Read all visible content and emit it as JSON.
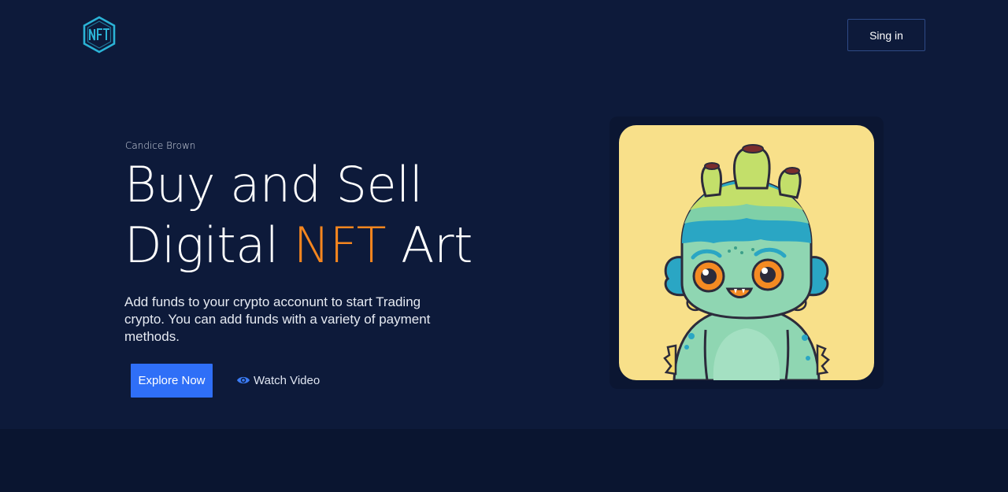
{
  "header": {
    "logo_text": "NFT",
    "signin_label": "Sing in"
  },
  "hero": {
    "author": "Candice Brown",
    "headline_line1": "Buy and Sell",
    "headline_line2_pre": "Digital ",
    "headline_line2_accent": "NFT",
    "headline_line2_post": " Art",
    "description": "Add funds to your crypto acconunt to start Trading crypto. You can add funds with a variety of payment methods.",
    "explore_label": "Explore Now",
    "watch_label": "Watch Video",
    "watch_icon": "eye-icon"
  },
  "artwork": {
    "subject": "fish-creature-nft",
    "background_color": "#f8e08a"
  },
  "colors": {
    "background": "#0d1a3a",
    "accent": "#f5861f",
    "primary_button": "#2f6ff7",
    "logo": "#2bb3d6"
  }
}
